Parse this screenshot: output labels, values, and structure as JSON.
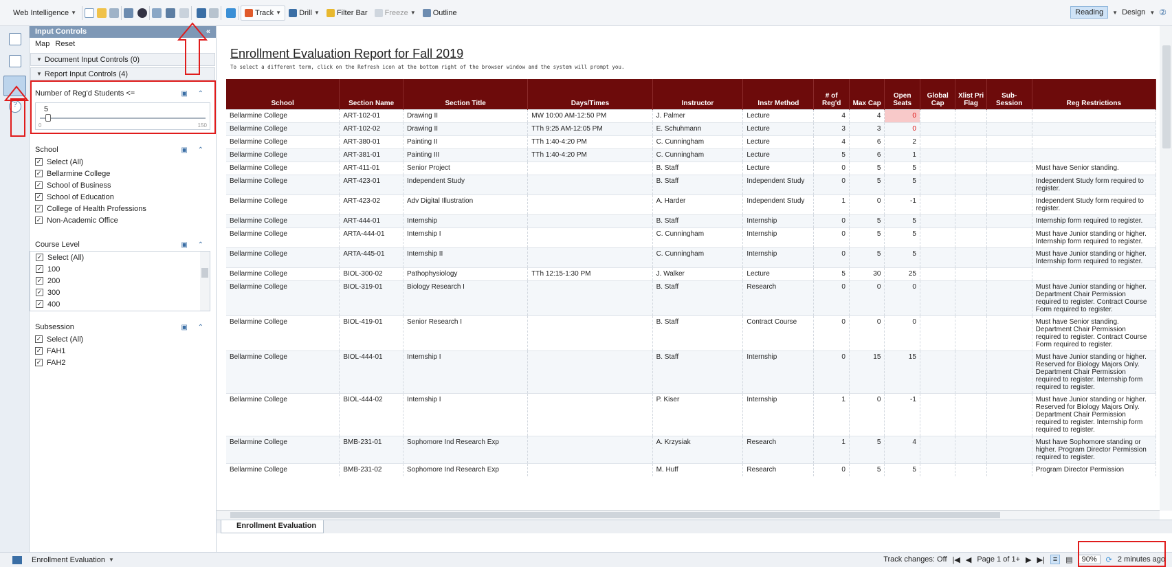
{
  "toolbar": {
    "app_menu": "Web Intelligence",
    "track": "Track",
    "drill": "Drill",
    "filter_bar": "Filter Bar",
    "freeze": "Freeze",
    "outline": "Outline",
    "reading": "Reading",
    "design": "Design"
  },
  "panel": {
    "title": "Input Controls",
    "map": "Map",
    "reset": "Reset",
    "doc_controls": "Document Input Controls (0)",
    "report_controls": "Report Input Controls (4)",
    "slider": {
      "title": "Number of Reg'd Students <=",
      "value": "5",
      "min": "0",
      "max": "150",
      "fraction": 0.033
    },
    "school": {
      "title": "School",
      "items": [
        "Select (All)",
        "Bellarmine College",
        "School of Business",
        "School of Education",
        "College of Health Professions",
        "Non-Academic Office"
      ]
    },
    "course_level": {
      "title": "Course Level",
      "items": [
        "Select (All)",
        "100",
        "200",
        "300",
        "400"
      ]
    },
    "subsession": {
      "title": "Subsession",
      "items": [
        "Select (All)",
        "FAH1",
        "FAH2"
      ]
    }
  },
  "report": {
    "title": "Enrollment Evaluation Report for Fall 2019",
    "subtitle": "To select a different term, click on the Refresh icon at the bottom right of the browser window and the system will prompt you.",
    "headers": [
      "School",
      "Section Name",
      "Section Title",
      "Days/Times",
      "Instructor",
      "Instr Method",
      "# of Reg'd",
      "Max Cap",
      "Open Seats",
      "Global Cap",
      "Xlist Pri Flag",
      "Sub-Session",
      "Reg Restrictions"
    ],
    "rows": [
      [
        "Bellarmine College",
        "ART-102-01",
        "Drawing II",
        "MW  10:00 AM-12:50 PM",
        "J. Palmer",
        "Lecture",
        "4",
        "4",
        "0",
        "",
        "",
        "",
        ""
      ],
      [
        "Bellarmine College",
        "ART-102-02",
        "Drawing II",
        "TTh  9:25 AM-12:05 PM",
        "E. Schuhmann",
        "Lecture",
        "3",
        "3",
        "0",
        "",
        "",
        "",
        ""
      ],
      [
        "Bellarmine College",
        "ART-380-01",
        "Painting II",
        "TTh  1:40-4:20 PM",
        "C. Cunningham",
        "Lecture",
        "4",
        "6",
        "2",
        "",
        "",
        "",
        ""
      ],
      [
        "Bellarmine College",
        "ART-381-01",
        "Painting III",
        "TTh  1:40-4:20 PM",
        "C. Cunningham",
        "Lecture",
        "5",
        "6",
        "1",
        "",
        "",
        "",
        ""
      ],
      [
        "Bellarmine College",
        "ART-411-01",
        "Senior Project",
        "",
        "B. Staff",
        "Lecture",
        "0",
        "5",
        "5",
        "",
        "",
        "",
        "Must have Senior standing."
      ],
      [
        "Bellarmine College",
        "ART-423-01",
        "Independent Study",
        "",
        "B. Staff",
        "Independent Study",
        "0",
        "5",
        "5",
        "",
        "",
        "",
        "Independent Study form required to register."
      ],
      [
        "Bellarmine College",
        "ART-423-02",
        "Adv Digital Illustration",
        "",
        "A. Harder",
        "Independent Study",
        "1",
        "0",
        "-1",
        "",
        "",
        "",
        "Independent Study form required to register."
      ],
      [
        "Bellarmine College",
        "ART-444-01",
        "Internship",
        "",
        "B. Staff",
        "Internship",
        "0",
        "5",
        "5",
        "",
        "",
        "",
        "Internship form required to register."
      ],
      [
        "Bellarmine College",
        "ARTA-444-01",
        "Internship I",
        "",
        "C. Cunningham",
        "Internship",
        "0",
        "5",
        "5",
        "",
        "",
        "",
        "Must have Junior standing or higher. Internship form required to register."
      ],
      [
        "Bellarmine College",
        "ARTA-445-01",
        "Internship II",
        "",
        "C. Cunningham",
        "Internship",
        "0",
        "5",
        "5",
        "",
        "",
        "",
        "Must have Junior standing or higher. Internship form required to register."
      ],
      [
        "Bellarmine College",
        "BIOL-300-02",
        "Pathophysiology",
        "TTh  12:15-1:30 PM",
        "J. Walker",
        "Lecture",
        "5",
        "30",
        "25",
        "",
        "",
        "",
        ""
      ],
      [
        "Bellarmine College",
        "BIOL-319-01",
        "Biology Research I",
        "",
        "B. Staff",
        "Research",
        "0",
        "0",
        "0",
        "",
        "",
        "",
        "Must have Junior standing or higher. Department Chair Permission required to register. Contract Course Form required to register."
      ],
      [
        "Bellarmine College",
        "BIOL-419-01",
        "Senior Research I",
        "",
        "B. Staff",
        "Contract Course",
        "0",
        "0",
        "0",
        "",
        "",
        "",
        "Must have Senior standing. Department Chair Permission required to register. Contract Course Form required to register."
      ],
      [
        "Bellarmine College",
        "BIOL-444-01",
        "Internship I",
        "",
        "B. Staff",
        "Internship",
        "0",
        "15",
        "15",
        "",
        "",
        "",
        "Must have Junior standing or higher. Reserved for Biology Majors Only. Department Chair Permission required to register. Internship form required to register."
      ],
      [
        "Bellarmine College",
        "BIOL-444-02",
        "Internship I",
        "",
        "P. Kiser",
        "Internship",
        "1",
        "0",
        "-1",
        "",
        "",
        "",
        "Must have Junior standing or higher. Reserved for Biology Majors Only. Department Chair Permission required to register. Internship form required to register."
      ],
      [
        "Bellarmine College",
        "BMB-231-01",
        "Sophomore Ind Research Exp",
        "",
        "A. Krzysiak",
        "Research",
        "1",
        "5",
        "4",
        "",
        "",
        "",
        "Must have Sophomore standing or higher. Program Director Permission required to register."
      ],
      [
        "Bellarmine College",
        "BMB-231-02",
        "Sophomore Ind Research Exp",
        "",
        "M. Huff",
        "Research",
        "0",
        "5",
        "5",
        "",
        "",
        "",
        "Program Director Permission"
      ]
    ]
  },
  "tab": {
    "label": "Enrollment Evaluation"
  },
  "status": {
    "doc_name": "Enrollment Evaluation",
    "track_changes": "Track changes: Off",
    "page": "Page 1 of 1+",
    "zoom": "90%",
    "refreshed": "2 minutes ago"
  }
}
